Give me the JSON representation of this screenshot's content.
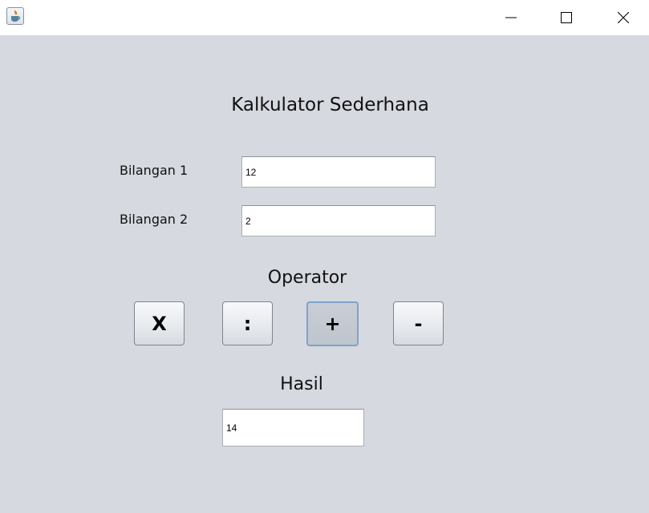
{
  "window": {
    "controls": {
      "minimize": "minimize-icon",
      "maximize": "maximize-icon",
      "close": "close-icon"
    }
  },
  "title": "Kalkulator Sederhana",
  "inputs": {
    "bilangan1": {
      "label": "Bilangan 1",
      "value": "12"
    },
    "bilangan2": {
      "label": "Bilangan 2",
      "value": "2"
    }
  },
  "operator": {
    "heading": "Operator",
    "buttons": [
      "X",
      ":",
      "+",
      "-"
    ],
    "focused": "+"
  },
  "result": {
    "heading": "Hasil",
    "value": "14"
  },
  "colors": {
    "background": "#d6d9df",
    "titlebar": "#ffffff",
    "focus_ring": "#7da2ce"
  }
}
